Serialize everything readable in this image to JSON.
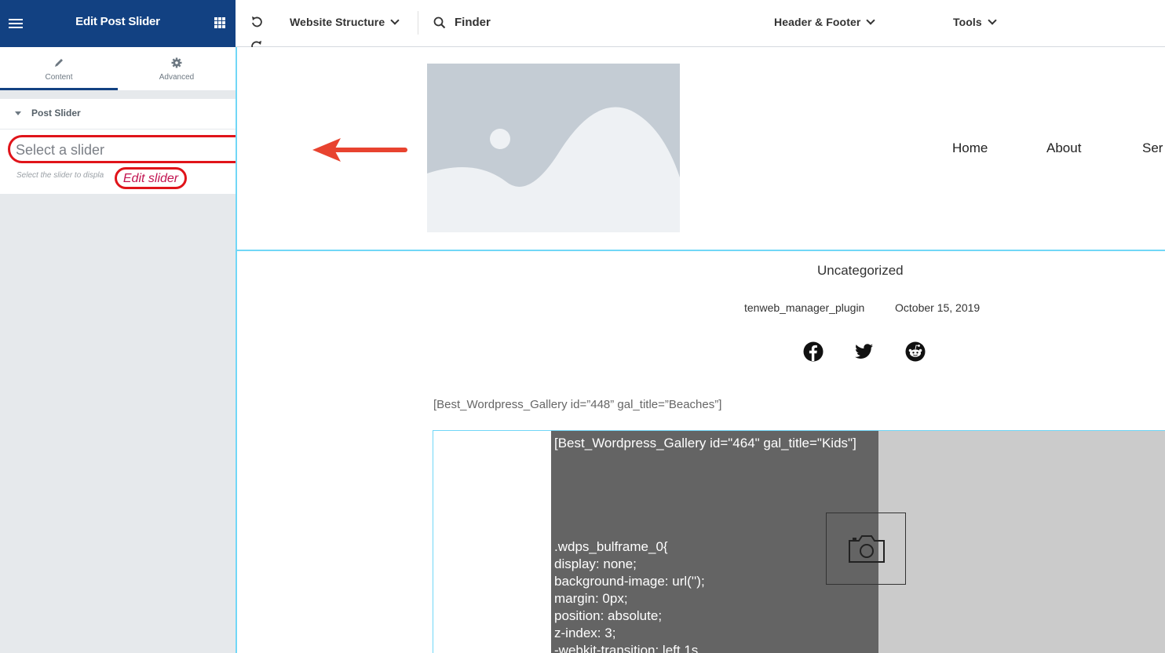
{
  "panel": {
    "title": "Edit Post Slider",
    "tabs": [
      {
        "label": "Content",
        "icon": "pencil-icon",
        "active": true
      },
      {
        "label": "Advanced",
        "icon": "gear-icon",
        "active": false
      }
    ],
    "section": {
      "title": "Post Slider",
      "select_placeholder": "Select a slider",
      "help_text": "Select the slider to displa",
      "edit_link": "Edit slider"
    }
  },
  "topbar": {
    "menus": [
      {
        "label": "Website Structure"
      },
      {
        "label": "Header & Footer"
      },
      {
        "label": "Tools"
      }
    ],
    "finder_label": "Finder"
  },
  "site": {
    "nav": [
      "Home",
      "About",
      "Ser"
    ]
  },
  "post": {
    "category": "Uncategorized",
    "author": "tenweb_manager_plugin",
    "date": "October 15, 2019",
    "social": [
      "facebook-icon",
      "twitter-icon",
      "reddit-icon"
    ],
    "shortcode_1": "[Best_Wordpress_Gallery id=”448” gal_title=”Beaches”]",
    "shortcode_2": "[Best_Wordpress_Gallery id=\"464\" gal_title=\"Kids\"]",
    "css_lines": [
      ".wdps_bulframe_0{",
      "display: none;",
      "background-image: url('');",
      "margin: 0px;",
      "position: absolute;",
      "z-index: 3;",
      "-webkit-transition: left 1s"
    ]
  },
  "colors": {
    "header_blue": "#124182",
    "highlight_red": "#e0141a",
    "link_crimson": "#c21350",
    "canvas_outline": "#71d7f7"
  }
}
